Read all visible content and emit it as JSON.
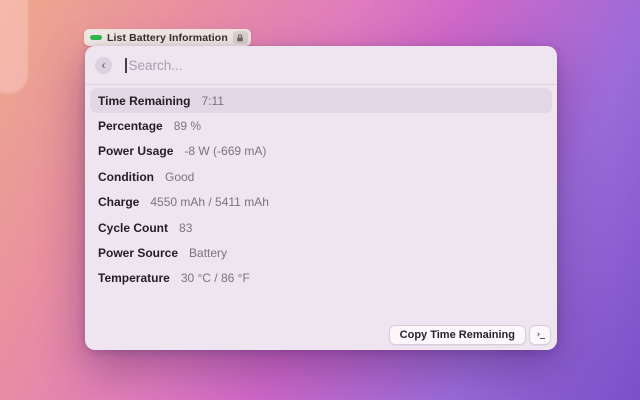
{
  "wallpaper": {
    "gradient_colors": [
      "#edaa8b",
      "#e07cbe",
      "#cf68c8",
      "#7b4fc8"
    ]
  },
  "tag": {
    "label": "List Battery Information",
    "icon": "battery-bar-icon",
    "icon_color": "#2eb94f",
    "badge_icon": "lock-icon"
  },
  "search": {
    "back_label": "‹",
    "placeholder": "Search..."
  },
  "list": [
    {
      "label": "Time Remaining",
      "value": "7:11",
      "selected": true
    },
    {
      "label": "Percentage",
      "value": "89 %",
      "selected": false
    },
    {
      "label": "Power Usage",
      "value": "-8 W (-669 mA)",
      "selected": false
    },
    {
      "label": "Condition",
      "value": "Good",
      "selected": false
    },
    {
      "label": "Charge",
      "value": "4550 mAh / 5411 mAh",
      "selected": false
    },
    {
      "label": "Cycle Count",
      "value": "83",
      "selected": false
    },
    {
      "label": "Power Source",
      "value": "Battery",
      "selected": false
    },
    {
      "label": "Temperature",
      "value": "30 °C / 86 °F",
      "selected": false
    }
  ],
  "footer": {
    "primary_action": "Copy Time Remaining",
    "terminal_glyph": "›_"
  },
  "colors": {
    "window_bg": "#efe5f0",
    "selected_row_bg": "#e2d7e5",
    "label_text": "#211e24",
    "value_text": "#7b7380"
  }
}
